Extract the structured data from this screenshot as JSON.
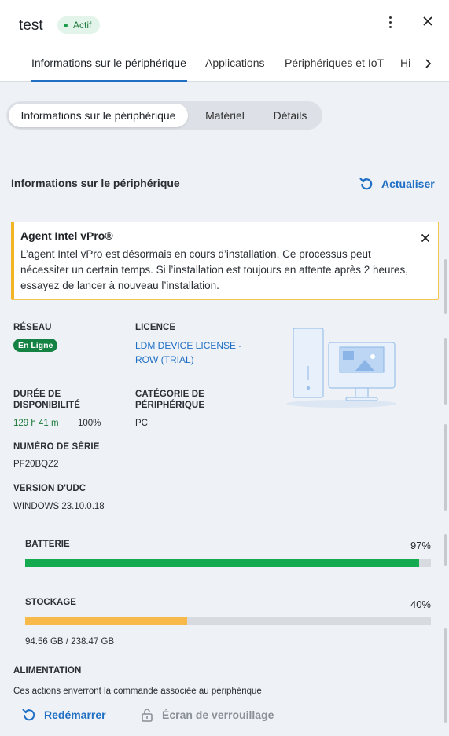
{
  "header": {
    "title": "test",
    "status": "Actif"
  },
  "tabs": [
    {
      "label": "Informations sur le périphérique",
      "active": true
    },
    {
      "label": "Applications"
    },
    {
      "label": "Périphériques et IoT"
    },
    {
      "label": "Hi"
    }
  ],
  "subtabs": [
    {
      "label": "Informations sur le périphérique",
      "active": true
    },
    {
      "label": "Matériel"
    },
    {
      "label": "Détails"
    }
  ],
  "section": {
    "title": "Informations sur le périphérique",
    "refresh_label": "Actualiser"
  },
  "alert": {
    "title": "Agent Intel vPro®",
    "body": "L’agent Intel vPro est désormais en cours d’installation. Ce processus peut nécessiter un certain temps. Si l’installation est toujours en attente après 2 heures, essayez de lancer à nouveau l’installation."
  },
  "info": {
    "network_label": "RÉSEAU",
    "network_value": "En Ligne",
    "license_label": "LICENCE",
    "license_value": "LDM DEVICE LICENSE - ROW (TRIAL)",
    "uptime_label_1": "DURÉE DE",
    "uptime_label_2": "DISPONIBILITÉ",
    "uptime_value": "129 h 41 m",
    "uptime_percent": "100%",
    "category_label_1": "CATÉGORIE DE",
    "category_label_2": "PÉRIPHÉRIQUE",
    "category_value": "PC",
    "serial_label": "NUMÉRO DE SÉRIE",
    "serial_value": "PF20BQZ2",
    "udc_label": "VERSION D'UDC",
    "udc_value": "WINDOWS 23.10.0.18"
  },
  "battery": {
    "label": "BATTERIE",
    "percent_text": "97%",
    "fill": 0.97,
    "color": "#14aa4f"
  },
  "storage": {
    "label": "STOCKAGE",
    "percent_text": "40%",
    "fill": 0.4,
    "color": "#f6b94a",
    "usage": "94.56 GB / 238.47 GB"
  },
  "power": {
    "label": "ALIMENTATION",
    "description": "Ces actions enverront la commande associée au périphérique",
    "restart_label": "Redémarrer",
    "lock_label": "Écran de verrouillage"
  },
  "colors": {
    "accent": "#1f6fc5",
    "online": "#148242",
    "warning": "#f3b526"
  }
}
